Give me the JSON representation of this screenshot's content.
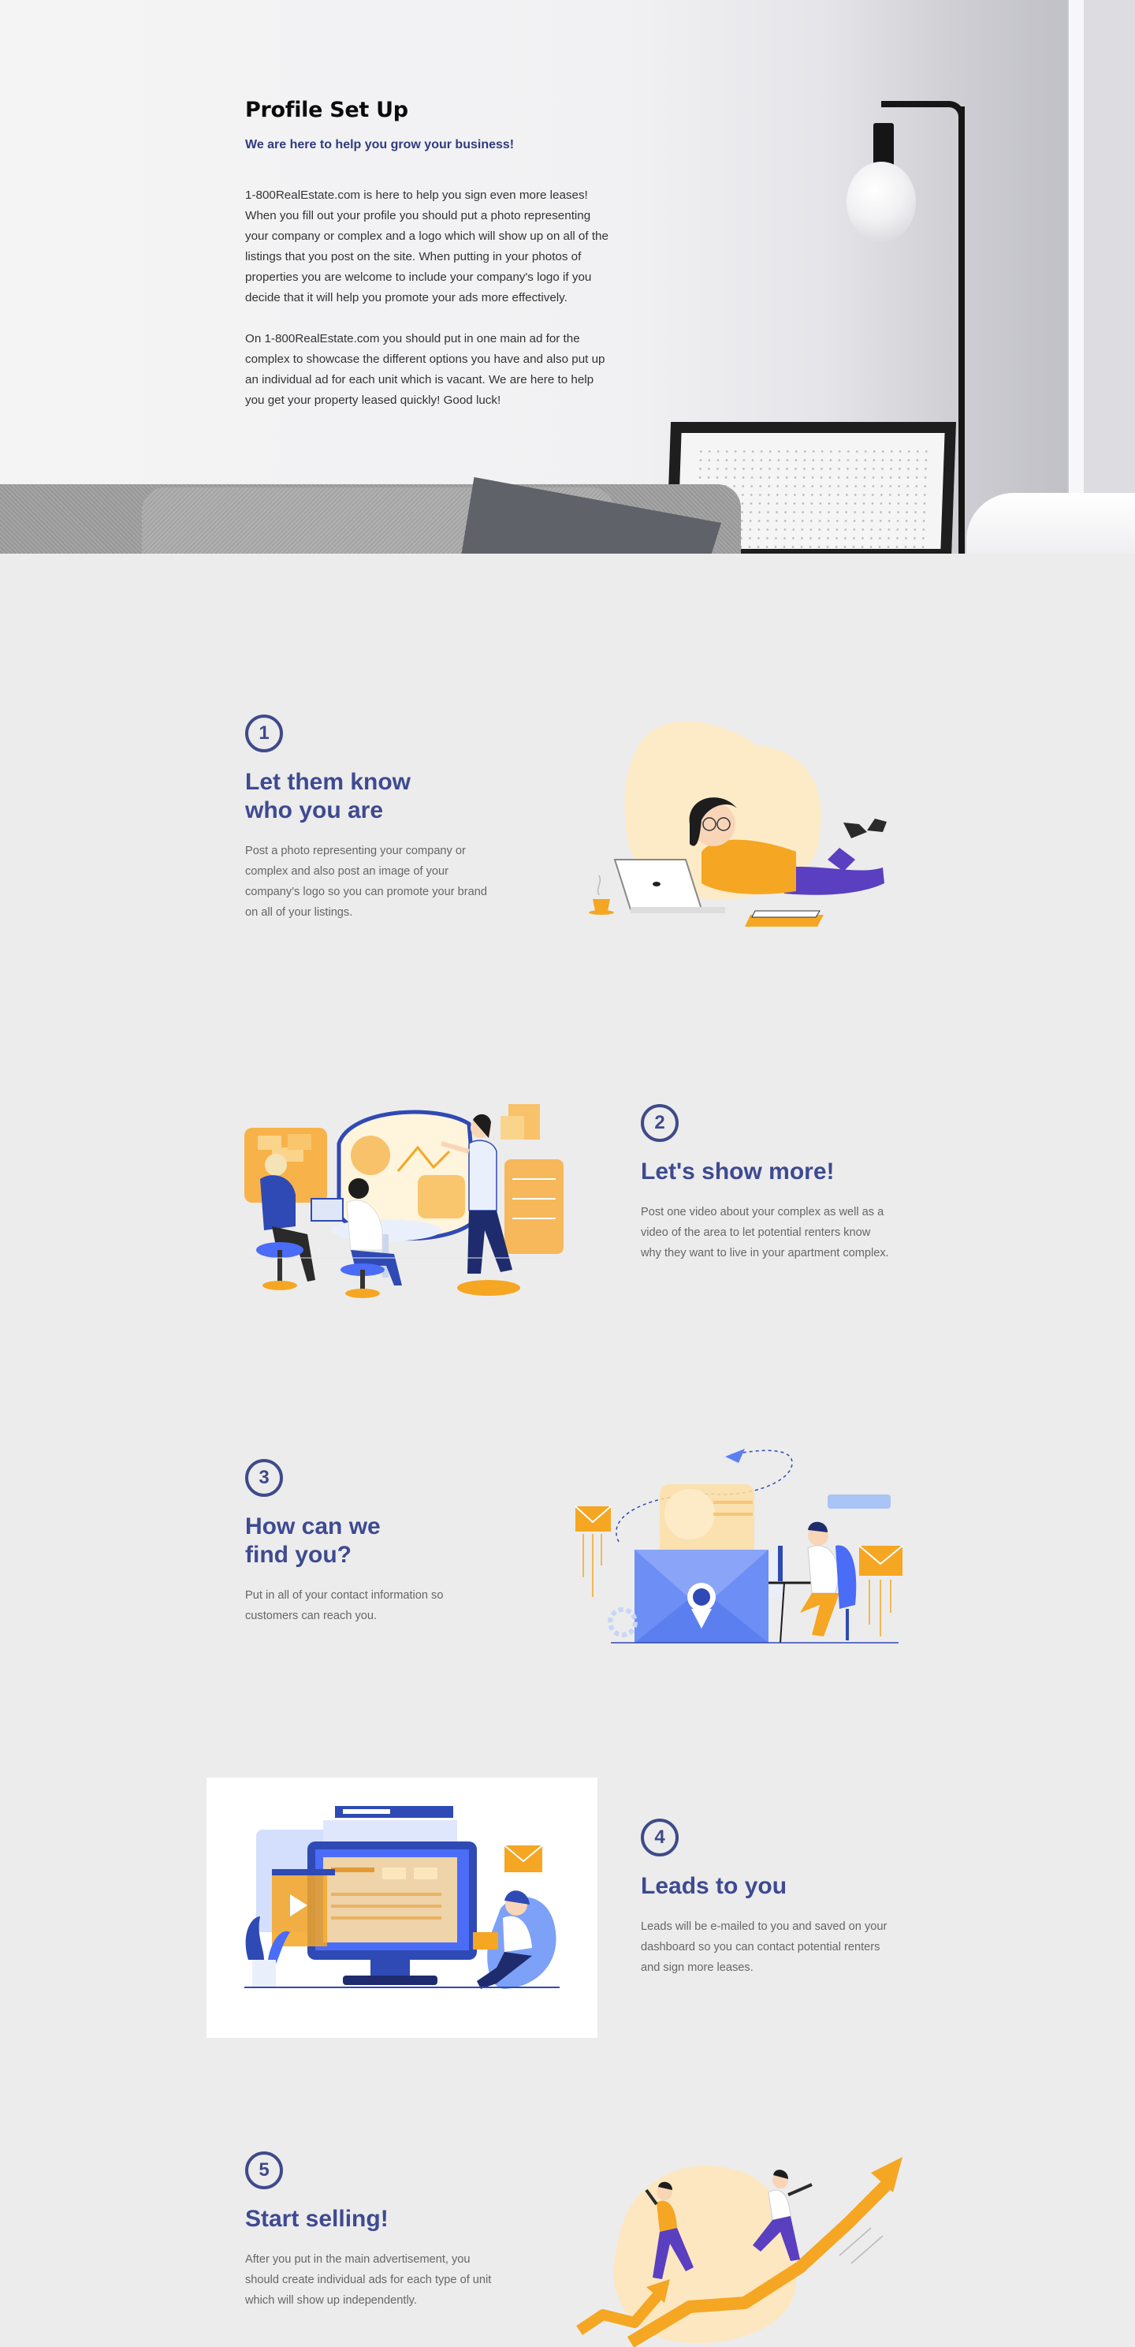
{
  "hero": {
    "title": "Profile Set Up",
    "subtitle": "We are here to help you grow your business!",
    "paragraphs": [
      "1-800RealEstate.com is here to help you sign even more leases!  When you fill out your profile you should put a photo representing your company or complex and a logo which will show up on all of the listings that you post on the site.  When putting in your photos of properties you are welcome to include your company's logo if you decide that it will help you promote your ads more effectively.",
      "On 1-800RealEstate.com you should put in one main ad for the complex to showcase the different options you have and also put up an individual ad for each unit which is vacant.  We are here to help you get your property leased quickly!  Good luck!"
    ]
  },
  "steps": [
    {
      "number": "1",
      "title_line1": "Let them know",
      "title_line2": "who you are",
      "description": "Post a photo representing your company or complex and also post an image of your company's logo so you can promote your brand on all of your listings.",
      "illustration": "woman-laptop-illustration"
    },
    {
      "number": "2",
      "title_line1": "Let's show more!",
      "title_line2": "",
      "description": "Post one video about your complex as well as a video of the area to let potential renters know why they want to live in your apartment complex.",
      "illustration": "team-presentation-illustration"
    },
    {
      "number": "3",
      "title_line1": "How can we",
      "title_line2": "find you?",
      "description": "Put in all of your contact information so customers can reach you.",
      "illustration": "contact-mail-illustration"
    },
    {
      "number": "4",
      "title_line1": "Leads to you",
      "title_line2": "",
      "description": "Leads will be e-mailed to you and saved on your dashboard so you can contact potential renters and sign more leases.",
      "illustration": "dashboard-leads-illustration"
    },
    {
      "number": "5",
      "title_line1": "Start selling!",
      "title_line2": "",
      "description": "After you put in the main advertisement, you should create individual ads for each type of unit which will show up independently.",
      "illustration": "growth-arrow-illustration"
    }
  ],
  "colors": {
    "accent": "#3e4a91",
    "orange": "#f5a623",
    "blue": "#4a6cf7",
    "background": "#ececec"
  }
}
